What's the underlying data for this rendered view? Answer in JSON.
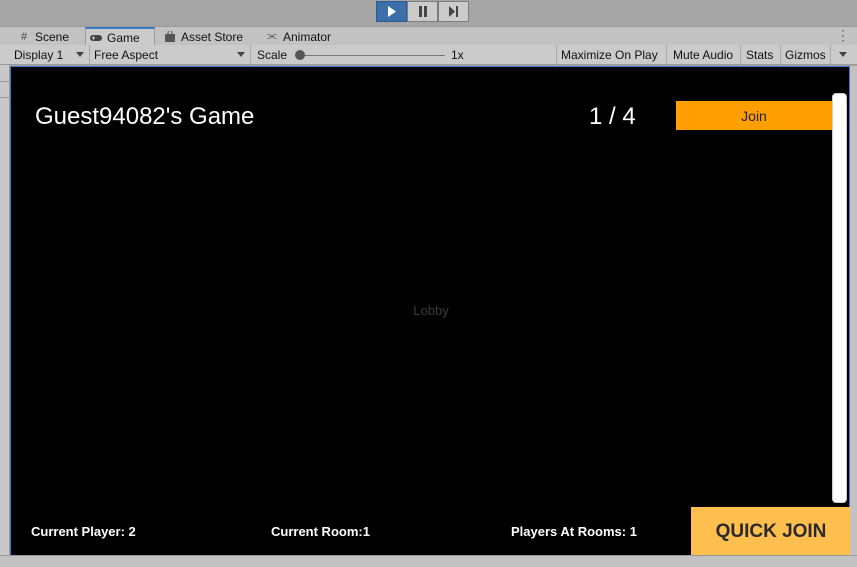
{
  "play_controls": {
    "play": "play-icon",
    "pause": "pause-icon",
    "step": "step-icon"
  },
  "tabs": [
    {
      "label": "Scene",
      "icon": "grid-icon"
    },
    {
      "label": "Game",
      "icon": "gamepad-icon"
    },
    {
      "label": "Asset Store",
      "icon": "bag-icon"
    },
    {
      "label": "Animator",
      "icon": "animator-icon"
    }
  ],
  "toolbar": {
    "display": "Display 1",
    "aspect": "Free Aspect",
    "scale_label": "Scale",
    "scale_value": "1x",
    "maximize": "Maximize On Play",
    "mute": "Mute Audio",
    "stats": "Stats",
    "gizmos": "Gizmos"
  },
  "game": {
    "title": "Guest94082's Game",
    "count": "1 / 4",
    "join_label": "Join",
    "lobby_label": "Lobby",
    "current_player": "Current Player: 2",
    "current_room": "Current Room:1",
    "players_at_rooms": "Players At Rooms: 1",
    "quick_join": "QUICK JOIN"
  },
  "colors": {
    "accent": "#3a79c8",
    "join_button": "#ffa000",
    "quick_join_button": "#ffbe4d"
  }
}
